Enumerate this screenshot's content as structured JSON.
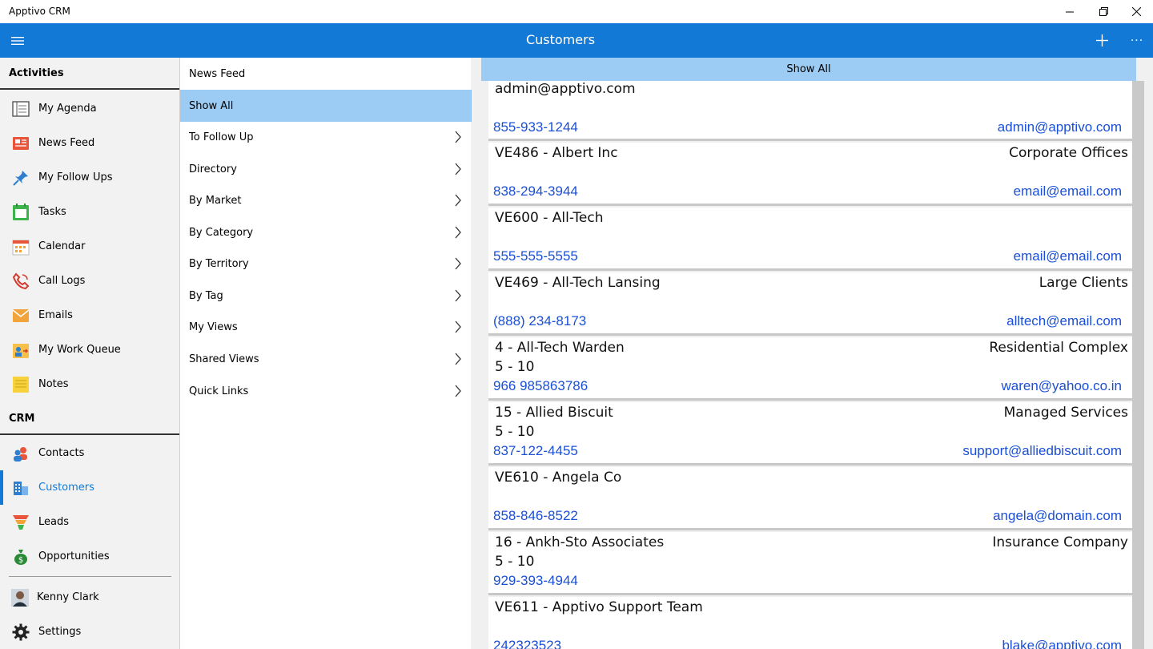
{
  "window": {
    "app_title": "Apptivo CRM"
  },
  "appbar": {
    "title": "Customers",
    "more": "···"
  },
  "sidebar": {
    "activities_heading": "Activities",
    "activities": [
      {
        "label": "My Agenda",
        "icon": "agenda-icon"
      },
      {
        "label": "News Feed",
        "icon": "news-feed-icon"
      },
      {
        "label": "My Follow Ups",
        "icon": "pin-icon"
      },
      {
        "label": "Tasks",
        "icon": "tasks-icon"
      },
      {
        "label": "Calendar",
        "icon": "calendar-icon"
      },
      {
        "label": "Call Logs",
        "icon": "phone-icon"
      },
      {
        "label": "Emails",
        "icon": "email-icon"
      },
      {
        "label": "My Work Queue",
        "icon": "work-queue-icon"
      },
      {
        "label": "Notes",
        "icon": "notes-icon"
      }
    ],
    "crm_heading": "CRM",
    "crm": [
      {
        "label": "Contacts",
        "icon": "contacts-icon"
      },
      {
        "label": "Customers",
        "icon": "customers-icon",
        "active": true
      },
      {
        "label": "Leads",
        "icon": "leads-funnel-icon"
      },
      {
        "label": "Opportunities",
        "icon": "money-bag-icon"
      }
    ],
    "user": {
      "label": "Kenny Clark",
      "icon": "avatar"
    },
    "settings": {
      "label": "Settings",
      "icon": "gear-icon"
    }
  },
  "filters": {
    "items": [
      {
        "label": "News Feed",
        "chevron": false
      },
      {
        "label": "Show All",
        "chevron": false,
        "selected": true
      },
      {
        "label": "To Follow Up",
        "chevron": true
      },
      {
        "label": "Directory",
        "chevron": true
      },
      {
        "label": "By Market",
        "chevron": true
      },
      {
        "label": "By Category",
        "chevron": true
      },
      {
        "label": "By Territory",
        "chevron": true
      },
      {
        "label": "By Tag",
        "chevron": true
      },
      {
        "label": "My Views",
        "chevron": true
      },
      {
        "label": "Shared Views",
        "chevron": true
      },
      {
        "label": "Quick Links",
        "chevron": true
      }
    ]
  },
  "list": {
    "header": "Show All",
    "customers": [
      {
        "name": "admin@apptivo.com",
        "category": "",
        "range": "",
        "phone": "855-933-1244",
        "email": "admin@apptivo.com"
      },
      {
        "name": "VE486 - Albert Inc",
        "category": "Corporate Offices",
        "range": "",
        "phone": "838-294-3944",
        "email": "email@email.com"
      },
      {
        "name": "VE600 - All-Tech",
        "category": "",
        "range": "",
        "phone": "555-555-5555",
        "email": "email@email.com"
      },
      {
        "name": "VE469 - All-Tech Lansing",
        "category": "Large Clients",
        "range": "",
        "phone": "(888) 234-8173",
        "email": "alltech@email.com"
      },
      {
        "name": "4 - All-Tech Warden",
        "category": "Residential Complex",
        "range": "5 - 10",
        "phone": "966 985863786",
        "email": "waren@yahoo.co.in"
      },
      {
        "name": "15 - Allied Biscuit",
        "category": "Managed Services",
        "range": "5 - 10",
        "phone": "837-122-4455",
        "email": "support@alliedbiscuit.com"
      },
      {
        "name": "VE610 - Angela Co",
        "category": "",
        "range": "",
        "phone": "858-846-8522",
        "email": "angela@domain.com"
      },
      {
        "name": "16 - Ankh-Sto Associates",
        "category": "Insurance Company",
        "range": "5 - 10",
        "phone": "929-393-4944",
        "email": ""
      },
      {
        "name": "VE611 - Apptivo Support Team",
        "category": "",
        "range": "",
        "phone": "242323523",
        "email": "blake@apptivo.com"
      }
    ]
  }
}
